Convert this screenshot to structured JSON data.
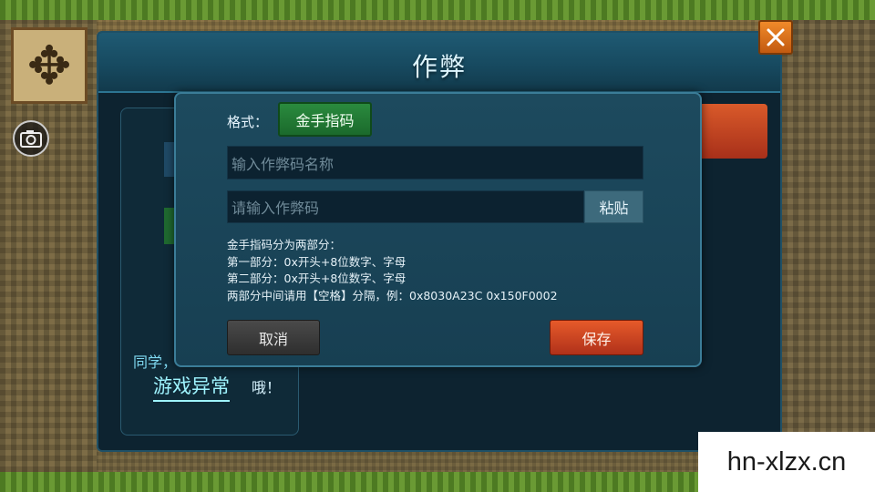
{
  "dialog": {
    "title": "作弊"
  },
  "background_card": {
    "line1": "同学，",
    "line2": "游戏异常",
    "line3": "哦！"
  },
  "form": {
    "format_label": "格式：",
    "format_value": "金手指码",
    "name_placeholder": "输入作弊码名称",
    "code_placeholder": "请输入作弊码",
    "paste_label": "粘贴",
    "description": [
      "金手指码分为两部分：",
      "第一部分：0x开头+8位数字、字母",
      "第二部分：0x开头+8位数字、字母",
      "两部分中间请用【空格】分隔，例：0x8030A23C 0x150F0002"
    ],
    "cancel_label": "取消",
    "save_label": "保存"
  },
  "icons": {
    "close": "close-icon",
    "camera": "camera-icon",
    "dpad": "dpad-icon"
  },
  "watermark": "hn-xlzx.cn",
  "colors": {
    "accent_green": "#2a8a3e",
    "save_red": "#d24a22",
    "close_orange": "#e07a22",
    "panel": "#1d4a5e"
  }
}
